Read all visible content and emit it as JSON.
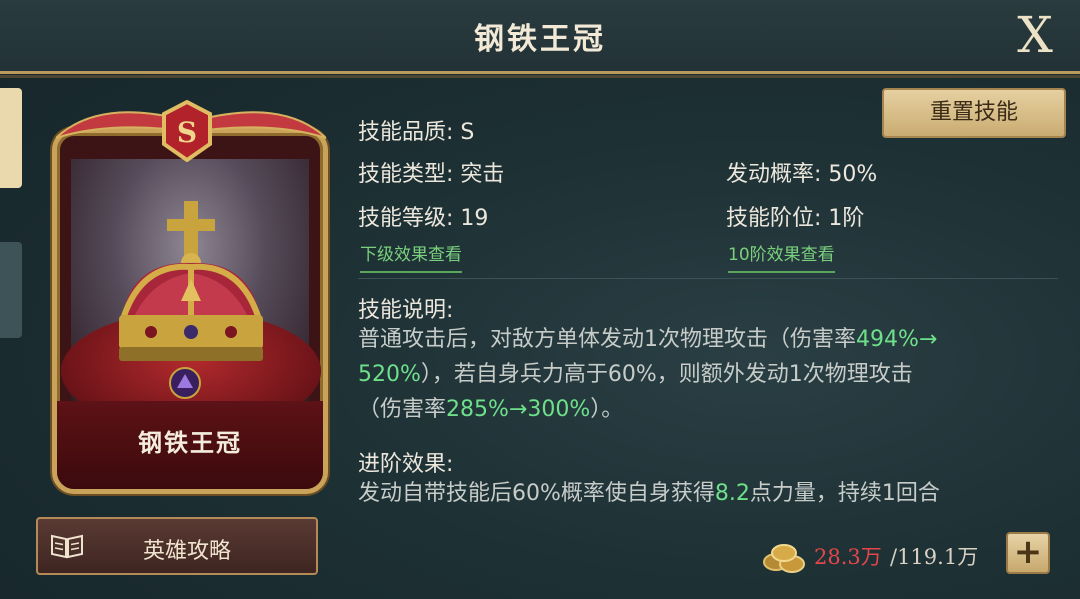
{
  "window": {
    "title": "钢铁王冠",
    "close_label": "X"
  },
  "card": {
    "grade": "S",
    "name": "钢铁王冠"
  },
  "guide_button": {
    "label": "英雄攻略"
  },
  "reset_button": {
    "label": "重置技能"
  },
  "skill": {
    "quality": "技能品质: S",
    "type": "技能类型: 突击",
    "trigger_rate": "发动概率: 50%",
    "level": "技能等级: 19",
    "tier": "技能阶位: 1阶",
    "next_level_link": "下级效果查看",
    "tier10_link": "10阶效果查看"
  },
  "description": {
    "heading": "技能说明:",
    "line1_a": "普通攻击后，对敌方单体发动1次物理攻击（伤害率",
    "line1_hl": "494%→",
    "line2_hl": "520%",
    "line2_b": "），若自身兵力高于60%，则额外发动1次物理攻击",
    "line3_a": "（伤害率",
    "line3_hl": "285%→300%",
    "line3_b": "）。"
  },
  "advance": {
    "heading": "进阶效果:",
    "line_a": "发动自带技能后60%概率使自身获得",
    "line_hl": "8.2",
    "line_b": "点力量，持续1回合"
  },
  "resource": {
    "icon": "coins-icon",
    "current": "28.3万",
    "max": "/119.1万",
    "add_label": "+"
  },
  "colors": {
    "accent_gold": "#caa35a",
    "highlight_green": "#6ee08a",
    "resource_red": "#e5464a"
  }
}
